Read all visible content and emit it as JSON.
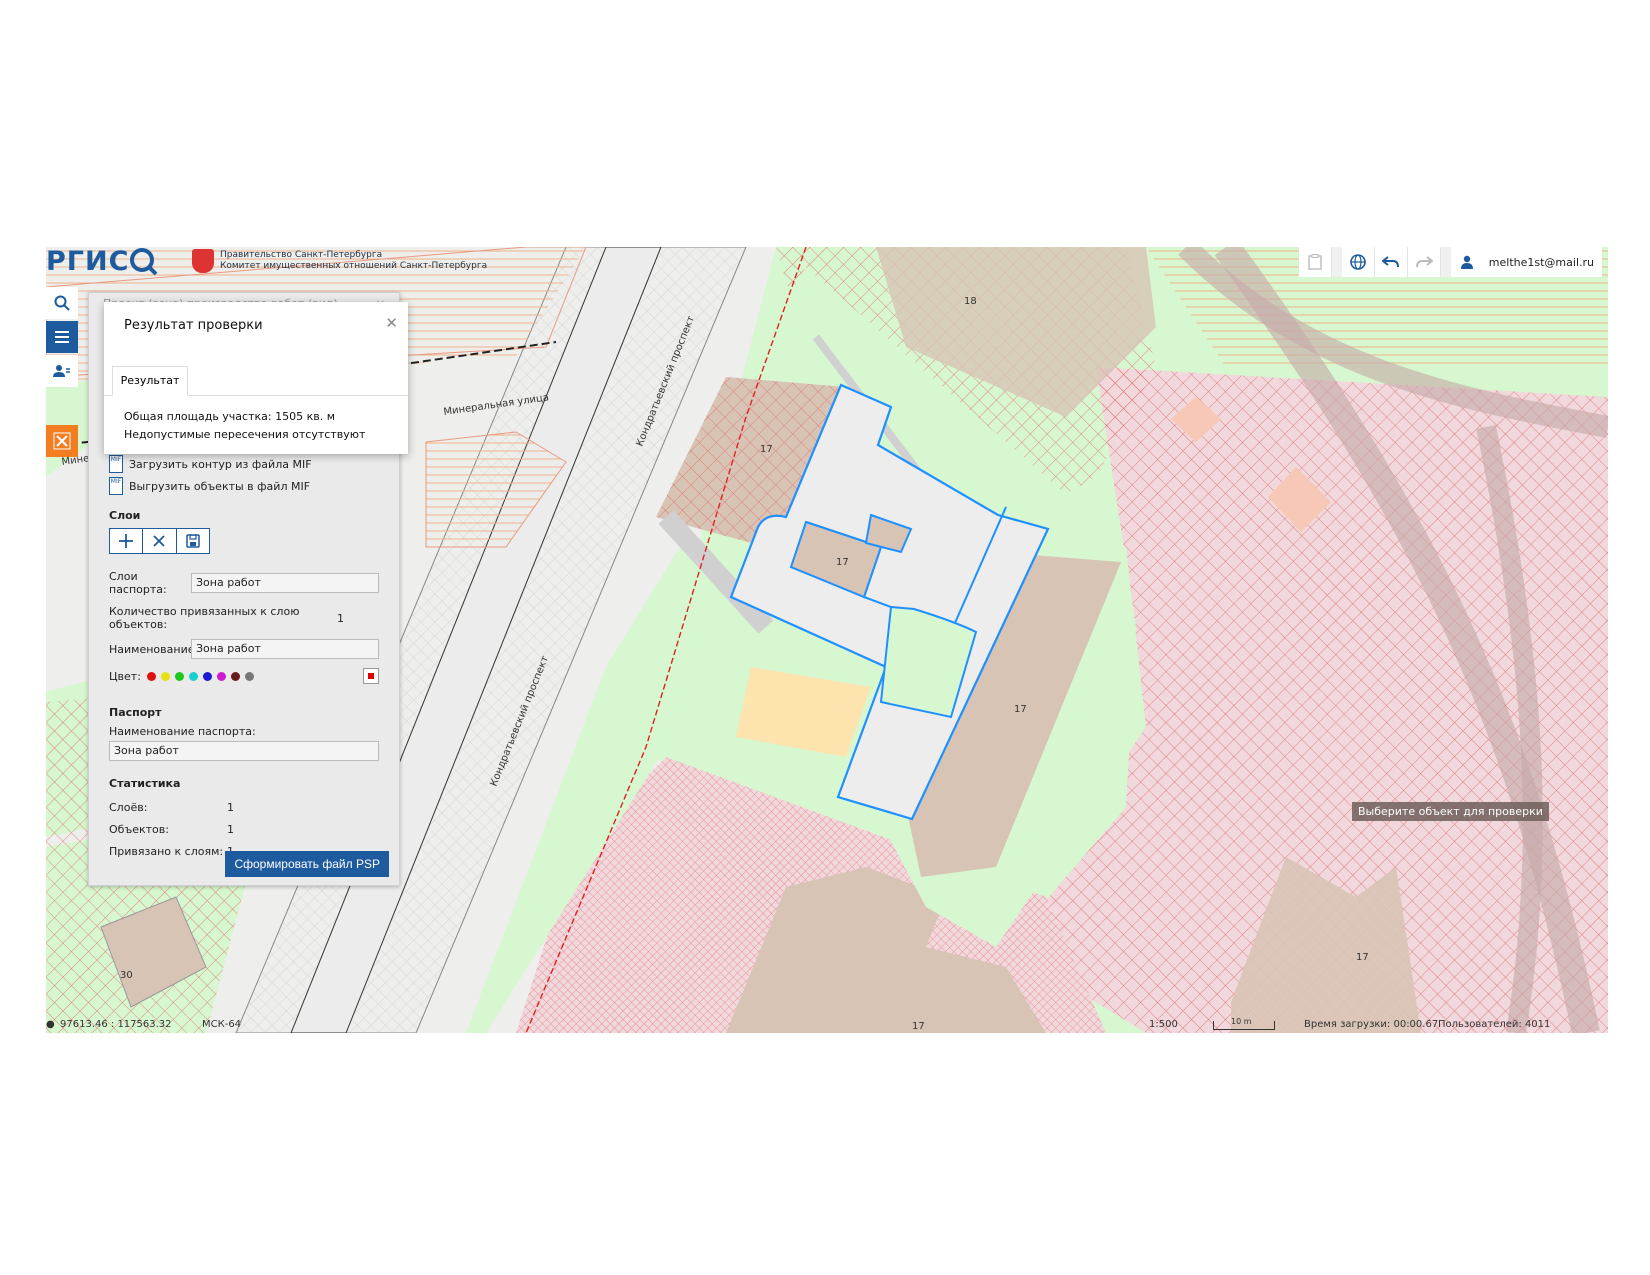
{
  "header": {
    "logo_text": "РГИС",
    "gov_line1": "Правительство Санкт-Петербурга",
    "gov_line2": "Комитет имущественных отношений Санкт-Петербурга",
    "user_email": "melthe1st@mail.ru"
  },
  "panel": {
    "title_partial": "Проект (зона) производства работ (вид) ...",
    "load_mif": "Загрузить контур из файла MIF",
    "export_mif": "Выгрузить объекты в файл MIF",
    "mif_label": "MIF",
    "layers_title": "Слои",
    "passport_layers_label": "Слои паспорта:",
    "passport_layers_value": "Зона работ",
    "bound_count_label": "Количество привязанных к слою объектов:",
    "bound_count_value": "1",
    "name_label": "Наименование:",
    "name_value": "Зона работ",
    "color_label": "Цвет:",
    "colors": [
      "#e01010",
      "#e8e010",
      "#1ec81e",
      "#19d0d0",
      "#1a1ad8",
      "#d01ad0",
      "#6a1a1a",
      "#777777"
    ],
    "passport_title": "Паспорт",
    "passport_name_label": "Наименование паспорта:",
    "passport_name_value": "Зона работ",
    "stats_title": "Статистика",
    "stats": [
      {
        "label": "Слоёв:",
        "value": "1"
      },
      {
        "label": "Объектов:",
        "value": "1"
      },
      {
        "label": "Привязано к слоям:",
        "value": "1"
      }
    ],
    "psp_button": "Сформировать файл PSP"
  },
  "dialog": {
    "title": "Результат проверки",
    "tab": "Результат",
    "area_line": "Общая площадь участка: 1505 кв. м",
    "intersection_line": "Недопустимые пересечения отсутствуют"
  },
  "map": {
    "tooltip": "Выберите объект для проверки",
    "street_labels": [
      "Кондратьевский проспект",
      "Кондратьевский проспект",
      "Минеральная улица",
      "Мине"
    ],
    "parcel_labels": [
      "18",
      "17",
      "17",
      "17",
      "17",
      "17",
      "30"
    ]
  },
  "statusbar": {
    "coordinates": "97613.46 : 117563.32",
    "crs": "МСК-64",
    "scale": "1:500",
    "scale_bar_label": "10 m",
    "load_time": "Время загрузки: 00:00.67",
    "users": "Пользователей: 4011"
  }
}
